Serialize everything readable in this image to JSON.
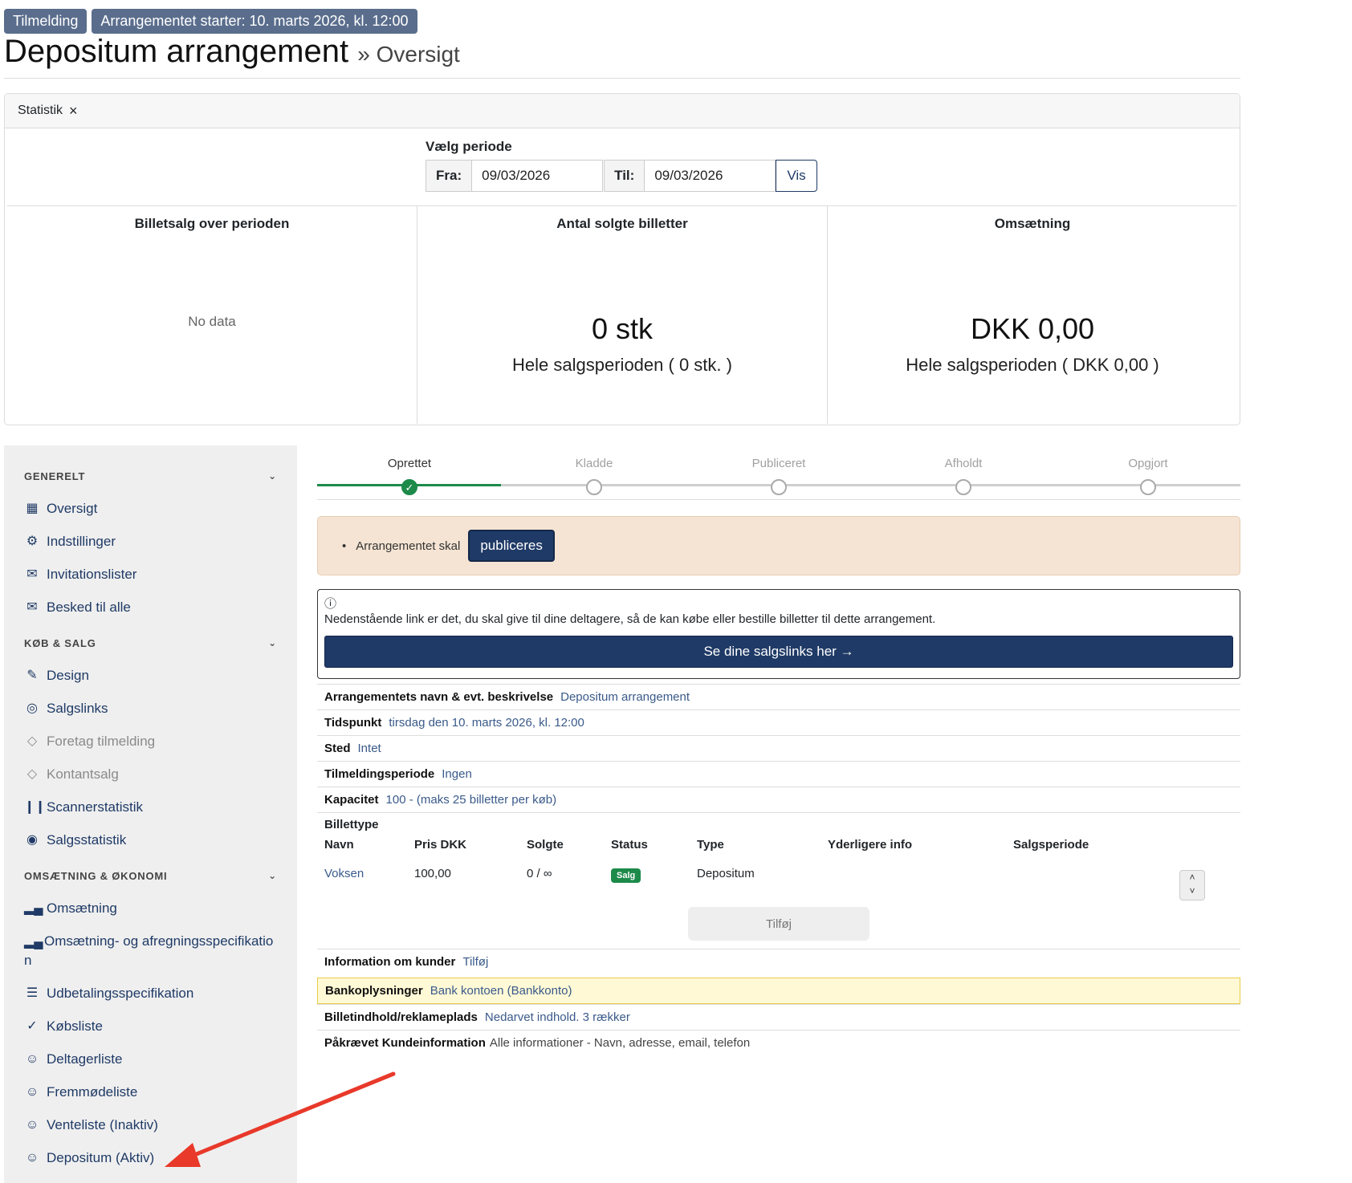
{
  "header": {
    "badge_status": "Tilmelding",
    "badge_start": "Arrangementet starter: 10. marts 2026, kl. 12:00",
    "title": "Depositum arrangement",
    "subtitle": "» Oversigt"
  },
  "statistics": {
    "header_label": "Statistik",
    "close_icon": "×",
    "period_label": "Vælg periode",
    "from_label": "Fra:",
    "from_value": "09/03/2026",
    "to_label": "Til:",
    "to_value": "09/03/2026",
    "show_button": "Vis",
    "col1_title": "Billetsalg over perioden",
    "col1_empty": "No data",
    "col2_title": "Antal solgte billetter",
    "col2_value": "0 stk",
    "col2_sub": "Hele salgsperioden ( 0 stk. )",
    "col3_title": "Omsætning",
    "col3_value": "DKK 0,00",
    "col3_sub": "Hele salgsperioden ( DKK 0,00 )"
  },
  "sidebar": {
    "sections": [
      {
        "label": "GENERELT",
        "items": [
          {
            "label": "Oversigt",
            "icon": "table-icon"
          },
          {
            "label": "Indstillinger",
            "icon": "gear-icon"
          },
          {
            "label": "Invitationslister",
            "icon": "envelope-icon"
          },
          {
            "label": "Besked til alle",
            "icon": "envelope-icon"
          }
        ]
      },
      {
        "label": "KØB & SALG",
        "items": [
          {
            "label": "Design",
            "icon": "brush-icon"
          },
          {
            "label": "Salgslinks",
            "icon": "globe-icon"
          },
          {
            "label": "Foretag tilmelding",
            "icon": "tag-icon"
          },
          {
            "label": "Kontantsalg",
            "icon": "tags-icon"
          },
          {
            "label": "Scannerstatistik",
            "icon": "barcode-icon"
          },
          {
            "label": "Salgsstatistik",
            "icon": "cash-icon"
          }
        ]
      },
      {
        "label": "OMSÆTNING & ØKONOMI",
        "items": [
          {
            "label": "Omsætning",
            "icon": "bar-chart-icon"
          },
          {
            "label": "Omsætning- og afregningsspecifikation",
            "icon": "bar-chart-icon"
          },
          {
            "label": "Udbetalingsspecifikation",
            "icon": "list-icon"
          },
          {
            "label": "Købsliste",
            "icon": "check-icon"
          },
          {
            "label": "Deltagerliste",
            "icon": "person-icon"
          },
          {
            "label": "Fremmødeliste",
            "icon": "person-icon"
          },
          {
            "label": "Venteliste (Inaktiv)",
            "icon": "person-icon"
          },
          {
            "label": "Depositum (Aktiv)",
            "icon": "person-icon"
          }
        ]
      }
    ]
  },
  "stepper": {
    "steps": [
      "Oprettet",
      "Kladde",
      "Publiceret",
      "Afholdt",
      "Opgjort"
    ],
    "current_index": 0
  },
  "alert": {
    "text": "Arrangementet skal",
    "button": "publiceres"
  },
  "info_box": {
    "help_icon": "question-circle-icon",
    "text": "Nedenstående link er det, du skal give til dine deltagere, så de kan købe eller bestille billetter til dette arrangement.",
    "button": "Se dine salgslinks her →"
  },
  "details": {
    "name_label": "Arrangementets navn & evt. beskrivelse",
    "name_value": "Depositum arrangement",
    "time_label": "Tidspunkt",
    "time_value": "tirsdag den 10. marts 2026, kl. 12:00",
    "place_label": "Sted",
    "place_value": "Intet",
    "period_label": "Tilmeldingsperiode",
    "period_value": "Ingen",
    "capacity_label": "Kapacitet",
    "capacity_value": "100 - (maks 25 billetter per køb)",
    "ticket_label": "Billettype",
    "customer_label": "Information om kunder",
    "customer_value": "Tilføj",
    "bank_label": "Bankoplysninger",
    "bank_value": "Bank kontoen (Bankkonto)",
    "content_label": "Billetindhold/reklameplads",
    "content_value": "Nedarvet indhold. 3 rækker",
    "required_label": "Påkrævet Kundeinformation",
    "required_value": "Alle informationer - Navn, adresse, email, telefon"
  },
  "ticket_table": {
    "headers": {
      "name": "Navn",
      "price": "Pris DKK",
      "sold": "Solgte",
      "status": "Status",
      "type": "Type",
      "info": "Yderligere info",
      "period": "Salgsperiode"
    },
    "row": {
      "name": "Voksen",
      "price": "100,00",
      "sold": "0 / ∞",
      "status": "Salg",
      "type": "Depositum",
      "info": "",
      "period": ""
    },
    "add_button": "Tilføj"
  },
  "colors": {
    "primary": "#1f3a66",
    "success": "#1d8a4a",
    "alert_bg": "#f5e4d3",
    "highlight_bg": "#fff9d6",
    "annotation_arrow": "#e8392a"
  }
}
